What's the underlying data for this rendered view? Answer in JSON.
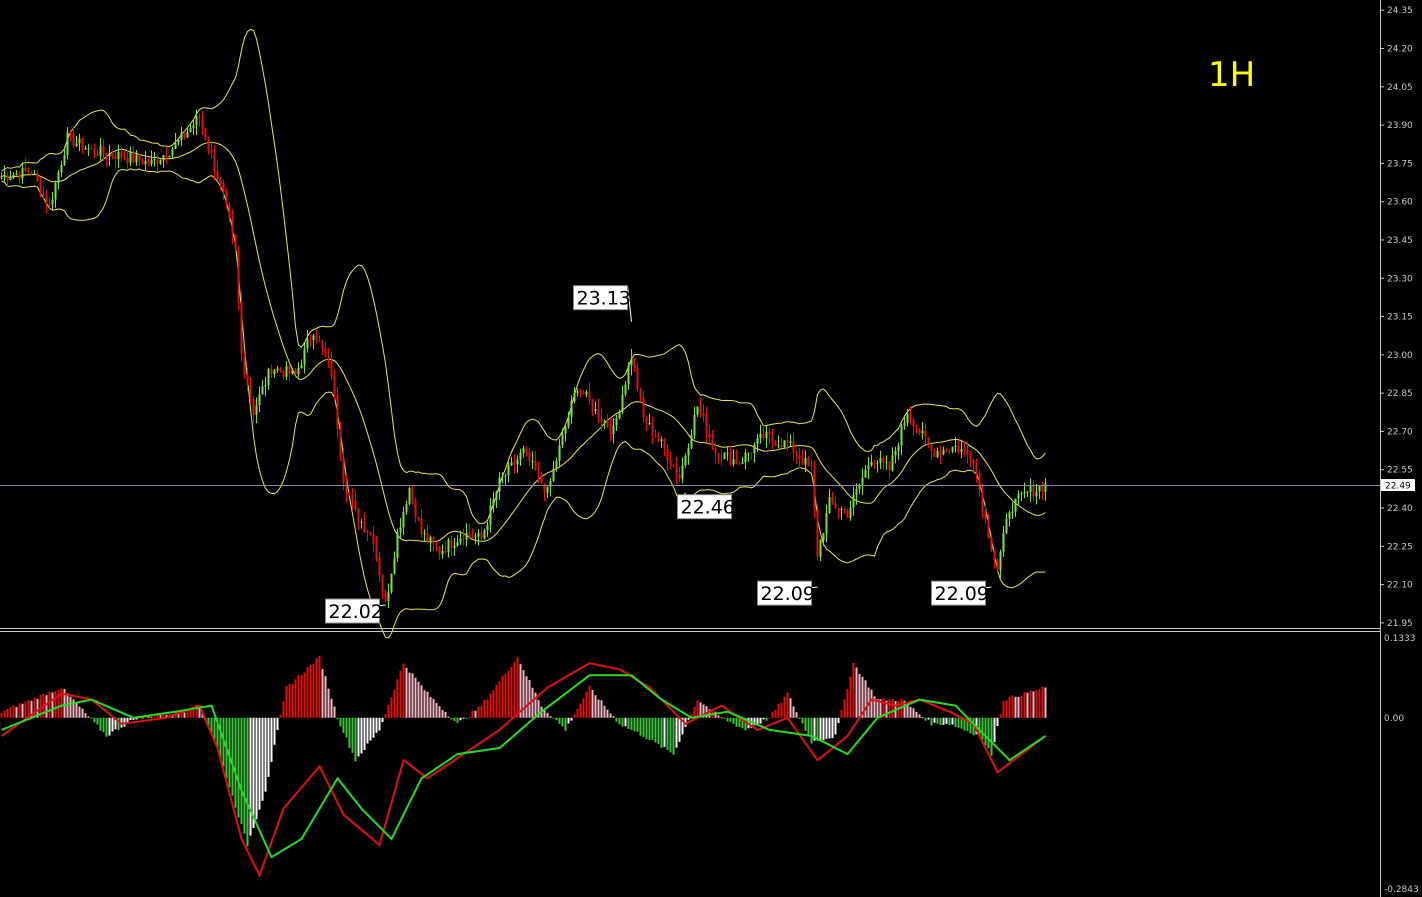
{
  "timeframe_label": "1H",
  "colors": {
    "background": "#000000",
    "bull_candle": "#7ee03a",
    "bear_candle": "#e01010",
    "bollinger": "#e8e84a",
    "macd_pos_strong": "#e01010",
    "macd_pos_weak": "#f4b6c2",
    "macd_neg_strong": "#3cc43c",
    "macd_neg_weak": "#ffffff",
    "macd_line": "#e01010",
    "signal_line": "#22dd22",
    "axis_text": "#c8c8c8"
  },
  "chart_data": [
    {
      "type": "candlestick",
      "price_ticks": [
        "24.35",
        "24.20",
        "24.05",
        "23.90",
        "23.75",
        "23.60",
        "23.45",
        "23.30",
        "23.15",
        "23.00",
        "22.85",
        "22.70",
        "22.55",
        "22.40",
        "22.25",
        "22.10",
        "21.95"
      ],
      "ylim": [
        21.93,
        24.39
      ],
      "last_price": "22.49",
      "annotations": [
        {
          "label": "23.13",
          "value": 23.13,
          "bar": 210
        },
        {
          "label": "22.46",
          "value": 22.46,
          "bar": 228
        },
        {
          "label": "22.09",
          "value": 22.09,
          "bar": 272
        },
        {
          "label": "22.09",
          "value": 22.09,
          "bar": 330
        },
        {
          "label": "22.02",
          "value": 22.02,
          "bar": 128
        }
      ],
      "price_path": [
        [
          0,
          23.7
        ],
        [
          10,
          23.72
        ],
        [
          16,
          23.58
        ],
        [
          22,
          23.85
        ],
        [
          30,
          23.8
        ],
        [
          40,
          23.78
        ],
        [
          50,
          23.75
        ],
        [
          58,
          23.82
        ],
        [
          66,
          23.93
        ],
        [
          70,
          23.78
        ],
        [
          74,
          23.62
        ],
        [
          78,
          23.4
        ],
        [
          80,
          23.0
        ],
        [
          84,
          22.78
        ],
        [
          90,
          22.95
        ],
        [
          98,
          22.92
        ],
        [
          104,
          23.1
        ],
        [
          110,
          22.93
        ],
        [
          114,
          22.52
        ],
        [
          118,
          22.38
        ],
        [
          124,
          22.28
        ],
        [
          128,
          22.02
        ],
        [
          132,
          22.3
        ],
        [
          136,
          22.48
        ],
        [
          140,
          22.3
        ],
        [
          146,
          22.23
        ],
        [
          154,
          22.3
        ],
        [
          160,
          22.28
        ],
        [
          166,
          22.5
        ],
        [
          174,
          22.62
        ],
        [
          182,
          22.46
        ],
        [
          188,
          22.72
        ],
        [
          192,
          22.88
        ],
        [
          198,
          22.78
        ],
        [
          204,
          22.7
        ],
        [
          210,
          23.0
        ],
        [
          214,
          22.75
        ],
        [
          220,
          22.65
        ],
        [
          226,
          22.52
        ],
        [
          232,
          22.8
        ],
        [
          238,
          22.62
        ],
        [
          246,
          22.58
        ],
        [
          254,
          22.68
        ],
        [
          262,
          22.65
        ],
        [
          270,
          22.55
        ],
        [
          272,
          22.22
        ],
        [
          276,
          22.42
        ],
        [
          282,
          22.38
        ],
        [
          290,
          22.6
        ],
        [
          296,
          22.55
        ],
        [
          302,
          22.78
        ],
        [
          310,
          22.62
        ],
        [
          318,
          22.64
        ],
        [
          324,
          22.6
        ],
        [
          328,
          22.35
        ],
        [
          332,
          22.16
        ],
        [
          336,
          22.4
        ],
        [
          342,
          22.46
        ],
        [
          348,
          22.49
        ]
      ],
      "bars": 349
    },
    {
      "type": "macd",
      "ticks": [
        "0.1333",
        "0.00",
        "-0.2843"
      ],
      "ylim": [
        -0.2843,
        0.1333
      ],
      "histogram_path": [
        [
          0,
          0.01
        ],
        [
          20,
          0.05
        ],
        [
          35,
          -0.03
        ],
        [
          45,
          0.0
        ],
        [
          60,
          0.01
        ],
        [
          66,
          0.02
        ],
        [
          72,
          -0.05
        ],
        [
          82,
          -0.21
        ],
        [
          88,
          -0.12
        ],
        [
          95,
          0.05
        ],
        [
          106,
          0.1
        ],
        [
          112,
          0.0
        ],
        [
          118,
          -0.07
        ],
        [
          126,
          -0.02
        ],
        [
          134,
          0.09
        ],
        [
          142,
          0.04
        ],
        [
          152,
          -0.01
        ],
        [
          160,
          0.02
        ],
        [
          172,
          0.1
        ],
        [
          180,
          0.02
        ],
        [
          188,
          -0.02
        ],
        [
          196,
          0.05
        ],
        [
          206,
          -0.01
        ],
        [
          214,
          -0.03
        ],
        [
          224,
          -0.06
        ],
        [
          232,
          0.03
        ],
        [
          240,
          0.0
        ],
        [
          248,
          -0.02
        ],
        [
          256,
          0.0
        ],
        [
          262,
          0.04
        ],
        [
          270,
          -0.04
        ],
        [
          278,
          -0.03
        ],
        [
          284,
          0.09
        ],
        [
          292,
          0.03
        ],
        [
          300,
          0.03
        ],
        [
          310,
          -0.01
        ],
        [
          316,
          -0.01
        ],
        [
          326,
          -0.03
        ],
        [
          330,
          -0.06
        ],
        [
          334,
          0.03
        ],
        [
          348,
          0.05
        ]
      ],
      "macd_path": [
        [
          0,
          -0.03
        ],
        [
          20,
          0.04
        ],
        [
          30,
          0.03
        ],
        [
          40,
          -0.01
        ],
        [
          55,
          0.0
        ],
        [
          66,
          0.02
        ],
        [
          72,
          -0.05
        ],
        [
          80,
          -0.2
        ],
        [
          86,
          -0.26
        ],
        [
          94,
          -0.15
        ],
        [
          106,
          -0.08
        ],
        [
          114,
          -0.16
        ],
        [
          126,
          -0.21
        ],
        [
          134,
          -0.07
        ],
        [
          142,
          -0.1
        ],
        [
          154,
          -0.06
        ],
        [
          166,
          -0.02
        ],
        [
          182,
          0.05
        ],
        [
          196,
          0.09
        ],
        [
          206,
          0.08
        ],
        [
          216,
          0.05
        ],
        [
          228,
          -0.01
        ],
        [
          240,
          0.02
        ],
        [
          252,
          -0.02
        ],
        [
          262,
          0.0
        ],
        [
          272,
          -0.07
        ],
        [
          282,
          -0.03
        ],
        [
          290,
          0.03
        ],
        [
          298,
          0.02
        ],
        [
          306,
          0.03
        ],
        [
          316,
          0.01
        ],
        [
          324,
          -0.01
        ],
        [
          332,
          -0.09
        ],
        [
          348,
          -0.03
        ]
      ],
      "signal_path": [
        [
          0,
          -0.02
        ],
        [
          20,
          0.02
        ],
        [
          30,
          0.03
        ],
        [
          44,
          0.0
        ],
        [
          58,
          0.01
        ],
        [
          70,
          0.02
        ],
        [
          80,
          -0.12
        ],
        [
          90,
          -0.23
        ],
        [
          100,
          -0.2
        ],
        [
          112,
          -0.1
        ],
        [
          120,
          -0.15
        ],
        [
          130,
          -0.2
        ],
        [
          140,
          -0.1
        ],
        [
          152,
          -0.06
        ],
        [
          166,
          -0.05
        ],
        [
          180,
          0.01
        ],
        [
          196,
          0.07
        ],
        [
          210,
          0.07
        ],
        [
          220,
          0.03
        ],
        [
          230,
          0.0
        ],
        [
          242,
          0.01
        ],
        [
          256,
          -0.02
        ],
        [
          270,
          -0.03
        ],
        [
          282,
          -0.06
        ],
        [
          292,
          0.0
        ],
        [
          306,
          0.03
        ],
        [
          318,
          0.02
        ],
        [
          328,
          -0.03
        ],
        [
          336,
          -0.07
        ],
        [
          348,
          -0.03
        ]
      ]
    }
  ]
}
